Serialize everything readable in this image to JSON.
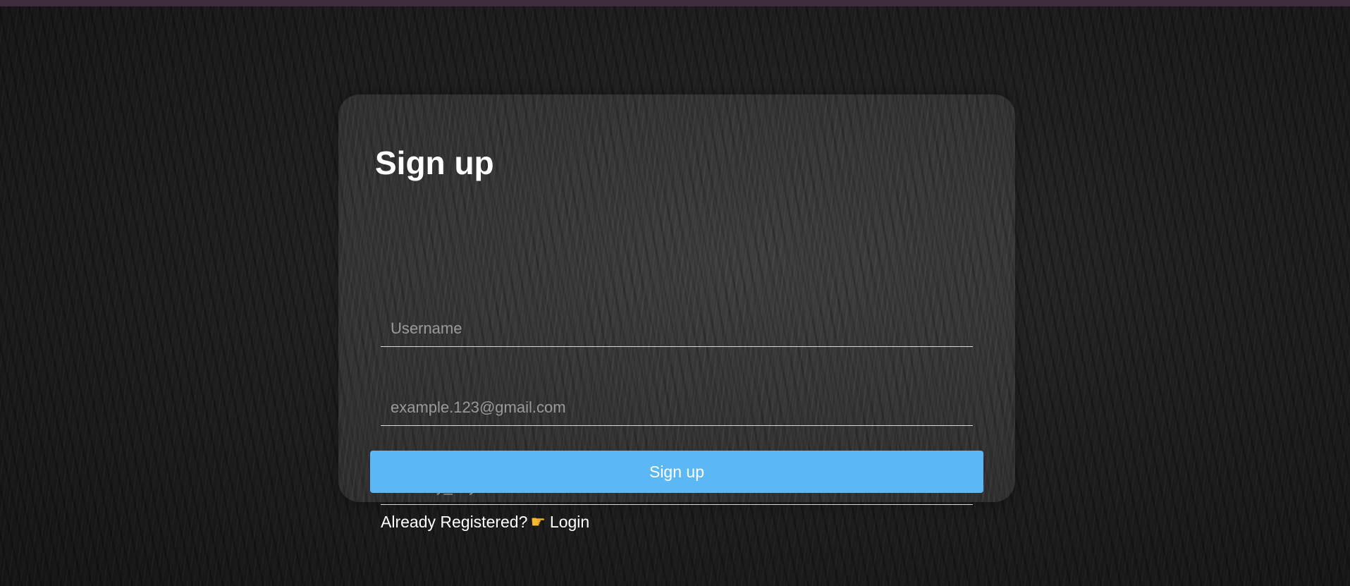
{
  "form": {
    "title": "Sign up",
    "username_placeholder": "Username",
    "email_placeholder": "example.123@gmail.com",
    "security_key_placeholder": "security_key",
    "submit_label": "Sign up"
  },
  "footer": {
    "prompt_text": "Already Registered?",
    "pointer_icon": "pointing-right-hand-icon",
    "login_link": "Login"
  },
  "colors": {
    "top_bar": "#3d2d3f",
    "button": "#5bb8f5",
    "text": "#ffffff",
    "placeholder": "#9a9a9a"
  }
}
